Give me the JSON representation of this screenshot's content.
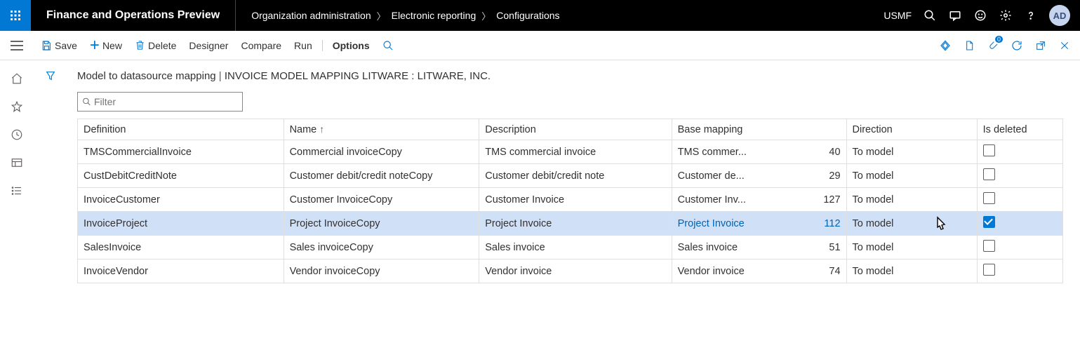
{
  "header": {
    "app_title": "Finance and Operations Preview",
    "breadcrumbs": [
      "Organization administration",
      "Electronic reporting",
      "Configurations"
    ],
    "company": "USMF",
    "avatar": "AD"
  },
  "toolbar": {
    "save": "Save",
    "new": "New",
    "delete": "Delete",
    "designer": "Designer",
    "compare": "Compare",
    "run": "Run",
    "options": "Options"
  },
  "page": {
    "title_left": "Model to datasource mapping",
    "title_sep": "   |   ",
    "title_right": "INVOICE MODEL MAPPING LITWARE : LITWARE, INC.",
    "filter_placeholder": "Filter"
  },
  "grid": {
    "columns": {
      "definition": "Definition",
      "name": "Name",
      "description": "Description",
      "base_mapping": "Base mapping",
      "direction": "Direction",
      "is_deleted": "Is deleted"
    },
    "rows": [
      {
        "definition": "TMSCommercialInvoice",
        "name": "Commercial invoiceCopy",
        "description": "TMS commercial invoice",
        "base_mapping_text": "TMS commer...",
        "base_mapping_num": 40,
        "direction": "To model",
        "is_deleted": false,
        "selected": false
      },
      {
        "definition": "CustDebitCreditNote",
        "name": "Customer debit/credit noteCopy",
        "description": "Customer debit/credit note",
        "base_mapping_text": "Customer de...",
        "base_mapping_num": 29,
        "direction": "To model",
        "is_deleted": false,
        "selected": false
      },
      {
        "definition": "InvoiceCustomer",
        "name": "Customer InvoiceCopy",
        "description": "Customer Invoice",
        "base_mapping_text": "Customer Inv...",
        "base_mapping_num": 127,
        "direction": "To model",
        "is_deleted": false,
        "selected": false
      },
      {
        "definition": "InvoiceProject",
        "name": "Project InvoiceCopy",
        "description": "Project Invoice",
        "base_mapping_text": "Project Invoice",
        "base_mapping_num": 112,
        "direction": "To model",
        "is_deleted": true,
        "selected": true
      },
      {
        "definition": "SalesInvoice",
        "name": "Sales invoiceCopy",
        "description": "Sales invoice",
        "base_mapping_text": "Sales invoice",
        "base_mapping_num": 51,
        "direction": "To model",
        "is_deleted": false,
        "selected": false
      },
      {
        "definition": "InvoiceVendor",
        "name": "Vendor invoiceCopy",
        "description": "Vendor invoice",
        "base_mapping_text": "Vendor invoice",
        "base_mapping_num": 74,
        "direction": "To model",
        "is_deleted": false,
        "selected": false
      }
    ]
  }
}
